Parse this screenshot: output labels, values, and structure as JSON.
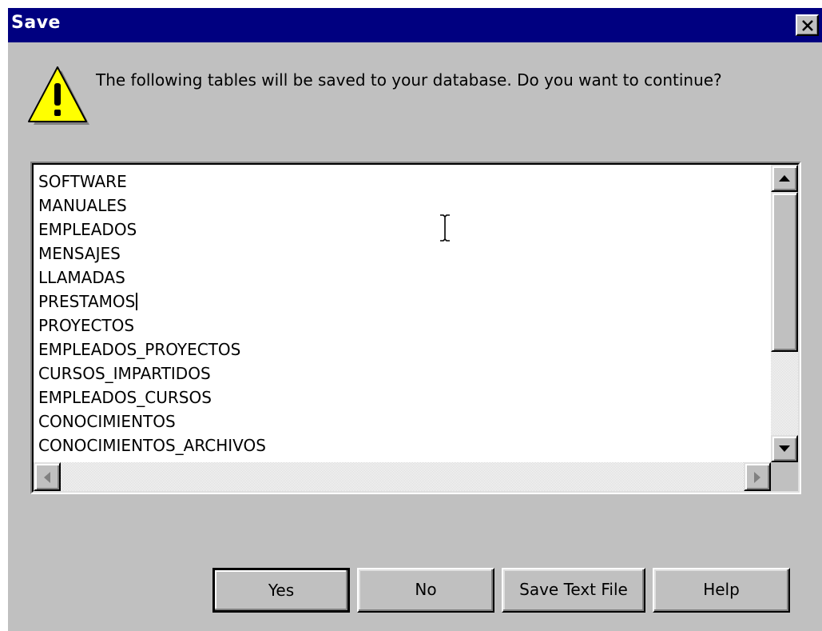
{
  "window": {
    "title": "Save",
    "close_icon": "close-x-icon"
  },
  "dialog": {
    "icon": "warning-triangle-icon",
    "message": "The following tables will be saved to your database. Do you want to continue?"
  },
  "tables": {
    "items": [
      {
        "label": "SOFTWARE"
      },
      {
        "label": "MANUALES"
      },
      {
        "label": "EMPLEADOS"
      },
      {
        "label": "MENSAJES"
      },
      {
        "label": "LLAMADAS"
      },
      {
        "label": "PRESTAMOS"
      },
      {
        "label": "PROYECTOS"
      },
      {
        "label": "EMPLEADOS_PROYECTOS"
      },
      {
        "label": "CURSOS_IMPARTIDOS"
      },
      {
        "label": "EMPLEADOS_CURSOS"
      },
      {
        "label": "CONOCIMIENTOS"
      },
      {
        "label": "CONOCIMIENTOS_ARCHIVOS"
      }
    ]
  },
  "buttons": {
    "yes": "Yes",
    "no": "No",
    "save_text_file": "Save Text File",
    "help": "Help"
  },
  "colors": {
    "title_bar": "#000080",
    "dialog_face": "#c0c0c0",
    "warning_yellow": "#ffff00"
  }
}
